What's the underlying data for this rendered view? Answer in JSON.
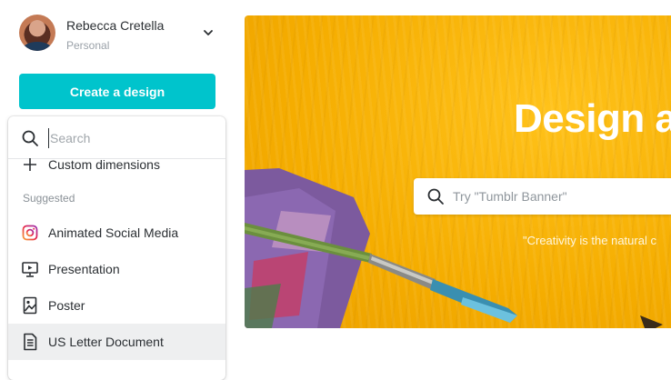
{
  "account": {
    "name": "Rebecca Cretella",
    "type": "Personal"
  },
  "create_button": {
    "label": "Create a design"
  },
  "dropdown": {
    "search_placeholder": "Search",
    "custom_dimensions_label": "Custom dimensions",
    "section_label": "Suggested",
    "items": [
      {
        "label": "Animated Social Media",
        "icon": "instagram-icon"
      },
      {
        "label": "Presentation",
        "icon": "presentation-icon"
      },
      {
        "label": "Poster",
        "icon": "poster-icon"
      },
      {
        "label": "US Letter Document",
        "icon": "document-icon",
        "highlighted": true
      }
    ]
  },
  "hero": {
    "title": "Design a",
    "search_placeholder": "Try \"Tumblr Banner\"",
    "quote": "\"Creativity is the natural c"
  },
  "colors": {
    "accent": "#00c4cc",
    "hero_yellow": "#f5ad00"
  }
}
